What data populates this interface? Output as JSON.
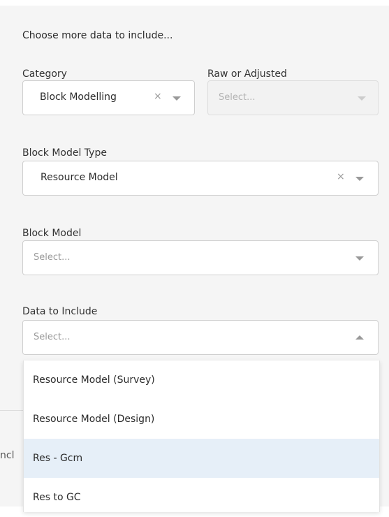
{
  "heading": "Choose more data to include...",
  "category": {
    "label": "Category",
    "value": "Block Modelling",
    "clear": "×"
  },
  "raw_or_adjusted": {
    "label": "Raw or Adjusted",
    "placeholder": "Select..."
  },
  "block_model_type": {
    "label": "Block Model Type",
    "value": "Resource Model",
    "clear": "×"
  },
  "block_model": {
    "label": "Block Model",
    "placeholder": "Select..."
  },
  "data_to_include": {
    "label": "Data to Include",
    "placeholder": "Select...",
    "options": [
      "Resource Model (Survey)",
      "Resource Model (Design)",
      "Res - Gcm",
      "Res to GC"
    ],
    "highlighted_index": 2
  },
  "background_partial_text": "ncl",
  "icons": {
    "clear": "close-icon",
    "dropdown": "chevron-down-icon",
    "dropdown_open": "chevron-up-icon"
  },
  "colors": {
    "panel_bg": "#f5f5f5",
    "highlight": "#e6eff8",
    "border": "#cfcfcf"
  }
}
